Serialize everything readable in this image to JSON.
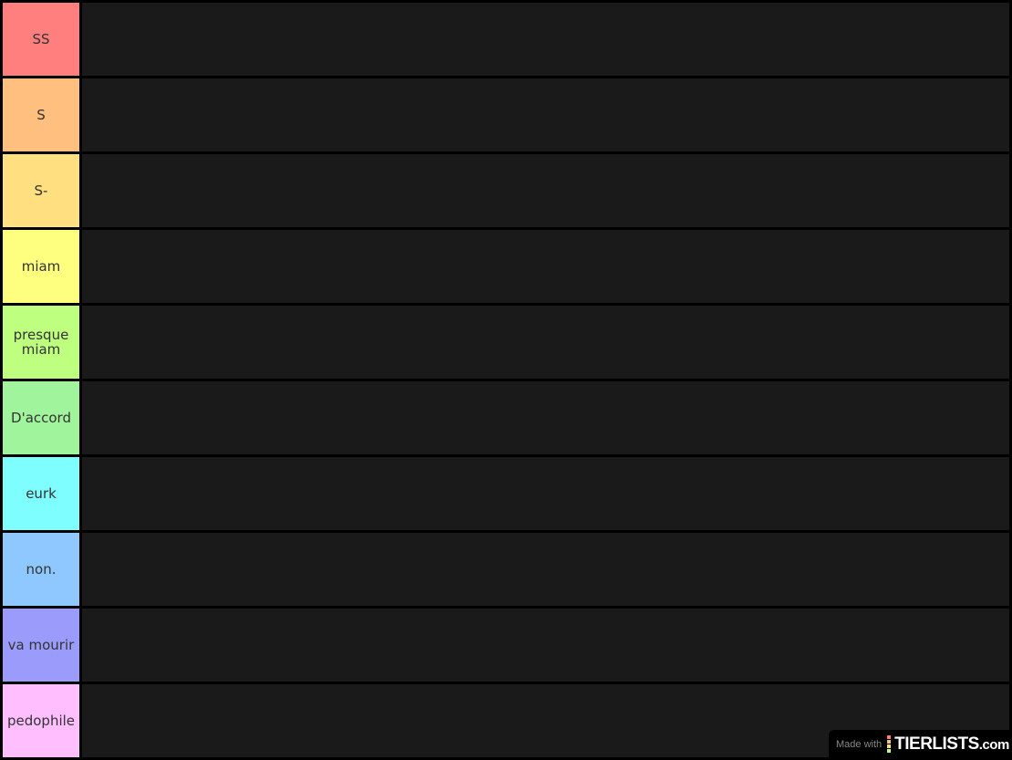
{
  "tiers": [
    {
      "label": "SS",
      "color": "#ff7f7f"
    },
    {
      "label": "S",
      "color": "#ffbf7f"
    },
    {
      "label": "S-",
      "color": "#ffdf7f"
    },
    {
      "label": "miam",
      "color": "#ffff7f"
    },
    {
      "label": "presque miam",
      "color": "#bfff7f"
    },
    {
      "label": "D'accord",
      "color": "#a0f59c"
    },
    {
      "label": "eurk",
      "color": "#7ffeff"
    },
    {
      "label": "non.",
      "color": "#8fc8ff"
    },
    {
      "label": "va mourir",
      "color": "#9b9bfb"
    },
    {
      "label": "pedophile",
      "color": "#ffbfff"
    }
  ],
  "watermark": {
    "prefix": "Made with",
    "brand": "TIERLISTS",
    "suffix": ".com",
    "bar_colors": [
      "#ff7f7f",
      "#ffbf7f",
      "#ffdf7f",
      "#bfff7f"
    ]
  }
}
